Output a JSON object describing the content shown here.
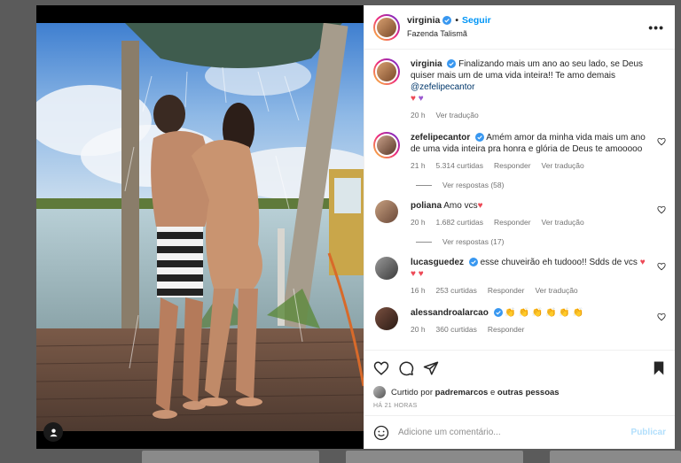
{
  "post": {
    "author": "virginia",
    "follow_label": "Seguir",
    "separator": "•",
    "location": "Fazenda Talismã",
    "more_label": "•••"
  },
  "caption": {
    "username": "virginia",
    "text": "Finalizando mais um ano ao seu lado, se Deus quiser mais um de uma vida inteira!! Te amo demais",
    "mention": "@zefelipecantor",
    "emojis": [
      "♥",
      "♥"
    ],
    "time": "20 h",
    "translate_label": "Ver tradução"
  },
  "comments": [
    {
      "username": "zefelipecantor",
      "verified": true,
      "text": "Amém amor da minha vida mais um ano de uma vida inteira pra honra e glória de Deus te amooooo",
      "time": "21 h",
      "likes": "5.314 curtidas",
      "reply_label": "Responder",
      "translate_label": "Ver tradução",
      "replies": "Ver respostas (58)"
    },
    {
      "username": "poliana",
      "verified": false,
      "text": "Amo vcs",
      "emoji": "♥",
      "time": "20 h",
      "likes": "1.682 curtidas",
      "reply_label": "Responder",
      "translate_label": "Ver tradução",
      "replies": "Ver respostas (17)"
    },
    {
      "username": "lucasguedez",
      "verified": true,
      "text": "esse chuveirão eh tudooo!! Sdds de vcs",
      "emoji": "♥ ♥ ♥",
      "time": "16 h",
      "likes": "253 curtidas",
      "reply_label": "Responder",
      "translate_label": "Ver tradução"
    },
    {
      "username": "alessandroalarcao",
      "verified": true,
      "text": "👏 👏 👏 👏 👏 👏",
      "time": "20 h",
      "likes": "360 curtidas",
      "reply_label": "Responder"
    }
  ],
  "likes_line": {
    "prefix": "Curtido por",
    "user": "padremarcos",
    "connector": "e",
    "others": "outras pessoas"
  },
  "time_ago": "HÁ 21 HORAS",
  "composer": {
    "placeholder": "Adicione um comentário...",
    "publish_label": "Publicar"
  },
  "colors": {
    "accent": "#0095f6",
    "heart": "#ed4956",
    "verified": "#3897f0"
  }
}
